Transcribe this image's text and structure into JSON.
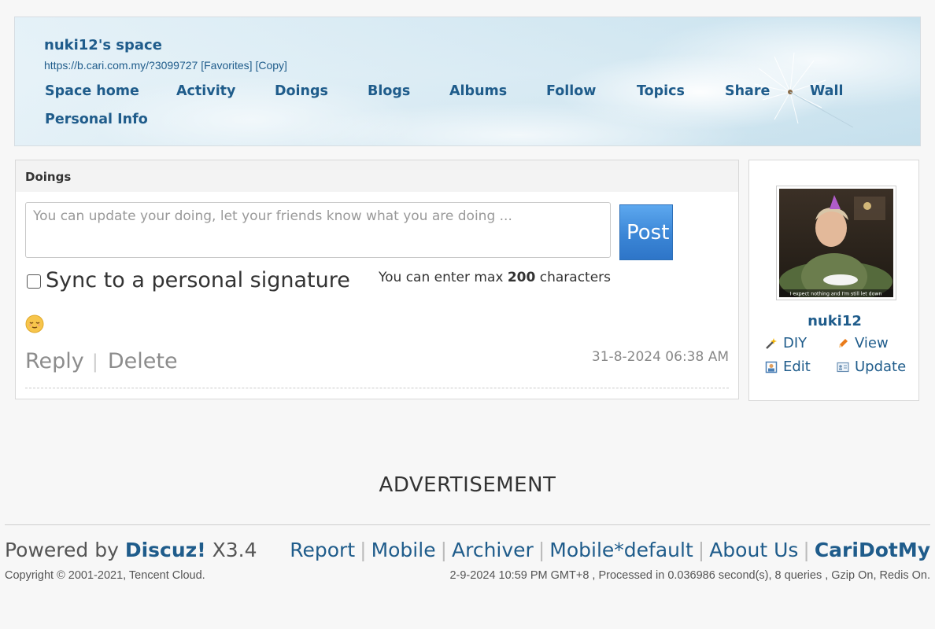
{
  "header": {
    "space_title": "nuki12's space",
    "space_url": "https://b.cari.com.my/?3099727",
    "favorites": "[Favorites]",
    "copy": "[Copy]",
    "nav": [
      {
        "label": "Space home"
      },
      {
        "label": "Activity"
      },
      {
        "label": "Doings"
      },
      {
        "label": "Blogs"
      },
      {
        "label": "Albums"
      },
      {
        "label": "Follow"
      },
      {
        "label": "Topics"
      },
      {
        "label": "Share"
      },
      {
        "label": "Wall"
      },
      {
        "label": "Personal Info"
      }
    ]
  },
  "doings": {
    "title": "Doings",
    "input_placeholder": "You can update your doing, let your friends know what you are doing ...",
    "post_label": "Post",
    "sync_label": "Sync to a personal signature",
    "max_prefix": "You can enter max",
    "max_count": "200",
    "max_suffix": "characters",
    "emoji_icon": "sleepy-face-emoji-icon",
    "reply_label": "Reply",
    "separator": "|",
    "delete_label": "Delete",
    "timestamp": "31-8-2024 06:38 AM"
  },
  "profile": {
    "avatar_caption": "I expect nothing and I'm still let down",
    "name": "nuki12",
    "links": {
      "diy": "DIY",
      "view": "View",
      "edit": "Edit",
      "update": "Update"
    },
    "icons": {
      "diy": "magic-wand-icon",
      "view": "pencil-icon",
      "edit": "picture-frame-icon",
      "update": "profile-card-icon"
    }
  },
  "advertisement": "ADVERTISEMENT",
  "footer": {
    "powered_prefix": "Powered by",
    "powered_brand": "Discuz!",
    "powered_version": "X3.4",
    "copyright": "Copyright © 2001-2021, Tencent Cloud.",
    "links": [
      "Report",
      "Mobile",
      "Archiver",
      "Mobile*default",
      "About Us"
    ],
    "brand_link": "CariDotMy",
    "server_info": "2-9-2024 10:59 PM GMT+8 , Processed in 0.036986 second(s), 8 queries , Gzip On, Redis On."
  },
  "colors": {
    "link": "#1f5c8b",
    "post_button": "#3b86d6",
    "page_bg": "#f7f7f7"
  }
}
